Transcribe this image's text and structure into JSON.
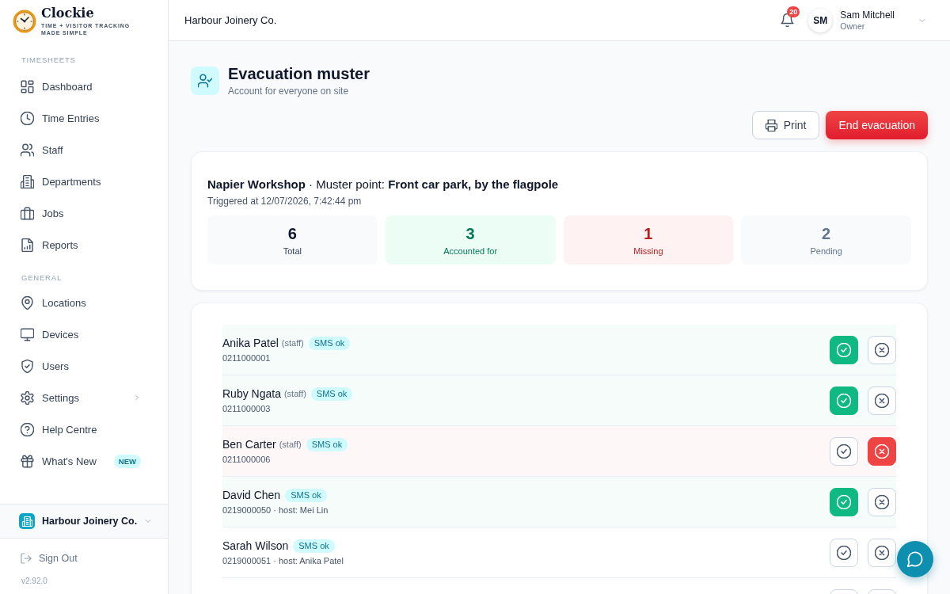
{
  "brand": {
    "name": "Clockie",
    "tagline": "TIME + VISITOR TRACKING MADE SIMPLE"
  },
  "sidebar": {
    "sections": [
      {
        "label": "TIMESHEETS",
        "items": [
          {
            "label": "Dashboard",
            "expandable": false
          },
          {
            "label": "Time Entries",
            "expandable": false
          },
          {
            "label": "Staff",
            "expandable": false
          },
          {
            "label": "Departments",
            "expandable": false
          },
          {
            "label": "Jobs",
            "expandable": false
          },
          {
            "label": "Reports",
            "expandable": false
          }
        ]
      },
      {
        "label": "GENERAL",
        "items": [
          {
            "label": "Locations",
            "expandable": false
          },
          {
            "label": "Devices",
            "expandable": false
          },
          {
            "label": "Users",
            "expandable": false
          },
          {
            "label": "Settings",
            "expandable": true
          },
          {
            "label": "Help Centre",
            "expandable": false
          },
          {
            "label": "What's New",
            "expandable": false,
            "badge": "NEW"
          }
        ]
      }
    ],
    "organization": "Harbour Joinery Co.",
    "sign_out": "Sign Out",
    "version": "v2.92.0"
  },
  "header": {
    "organization": "Harbour Joinery Co.",
    "notifications": "20",
    "user": {
      "initials": "SM",
      "name": "Sam Mitchell",
      "role": "Owner"
    }
  },
  "page": {
    "title": "Evacuation muster",
    "subtitle": "Account for everyone on site",
    "actions": [
      {
        "label": "Print",
        "kind": "secondary"
      },
      {
        "label": "End evacuation",
        "kind": "danger"
      }
    ]
  },
  "summary": {
    "heading": "**Napier Workshop** · Muster point: **Front car park, by the flagpole**",
    "triggered": "Triggered at 12/07/2026, 7:42:44 pm",
    "stats": [
      {
        "kind": "total",
        "value": "6",
        "label": "Total"
      },
      {
        "kind": "accounted",
        "value": "3",
        "label": "Accounted for"
      },
      {
        "kind": "missing",
        "value": "1",
        "label": "Missing"
      },
      {
        "kind": "pending",
        "value": "2",
        "label": "Pending"
      }
    ]
  },
  "people": [
    {
      "name": "Anika Patel",
      "role": "(staff)",
      "sms": "SMS ok",
      "detail": "0211000001",
      "accounted": true,
      "missing": false
    },
    {
      "name": "Ruby Ngata",
      "role": "(staff)",
      "sms": "SMS ok",
      "detail": "0211000003",
      "accounted": true,
      "missing": false
    },
    {
      "name": "Ben Carter",
      "role": "(staff)",
      "sms": "SMS ok",
      "detail": "0211000006",
      "accounted": false,
      "missing": true
    },
    {
      "name": "David Chen",
      "sms": "SMS ok",
      "detail": "0219000050 · host: Mei Lin",
      "accounted": true,
      "missing": false
    },
    {
      "name": "Sarah Wilson",
      "sms": "SMS ok",
      "detail": "0219000051 · host: Anika Patel",
      "accounted": false,
      "missing": false
    },
    {
      "accounted": false,
      "missing": false
    }
  ]
}
